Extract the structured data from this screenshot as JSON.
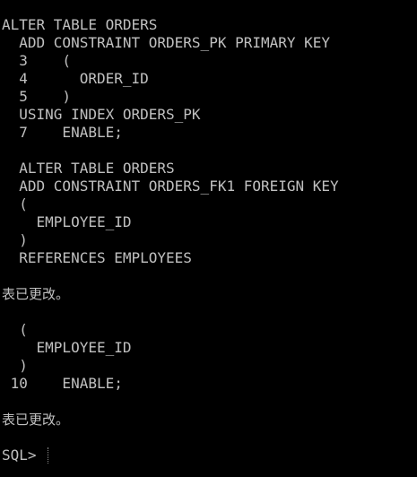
{
  "colors": {
    "background": "#000000",
    "text": "#c0c0c0"
  },
  "lines": [
    "ALTER TABLE ORDERS",
    "  ADD CONSTRAINT ORDERS_PK PRIMARY KEY",
    "  3    (",
    "  4      ORDER_ID",
    "  5    )",
    "  USING INDEX ORDERS_PK",
    "  7    ENABLE;",
    "",
    "  ALTER TABLE ORDERS",
    "  ADD CONSTRAINT ORDERS_FK1 FOREIGN KEY",
    "  (",
    "    EMPLOYEE_ID",
    "  )",
    "  REFERENCES EMPLOYEES",
    "",
    "表已更改。",
    "",
    "  (",
    "    EMPLOYEE_ID",
    "  )",
    " 10    ENABLE;",
    "",
    "表已更改。",
    "",
    "SQL>"
  ],
  "prompt": "SQL>"
}
